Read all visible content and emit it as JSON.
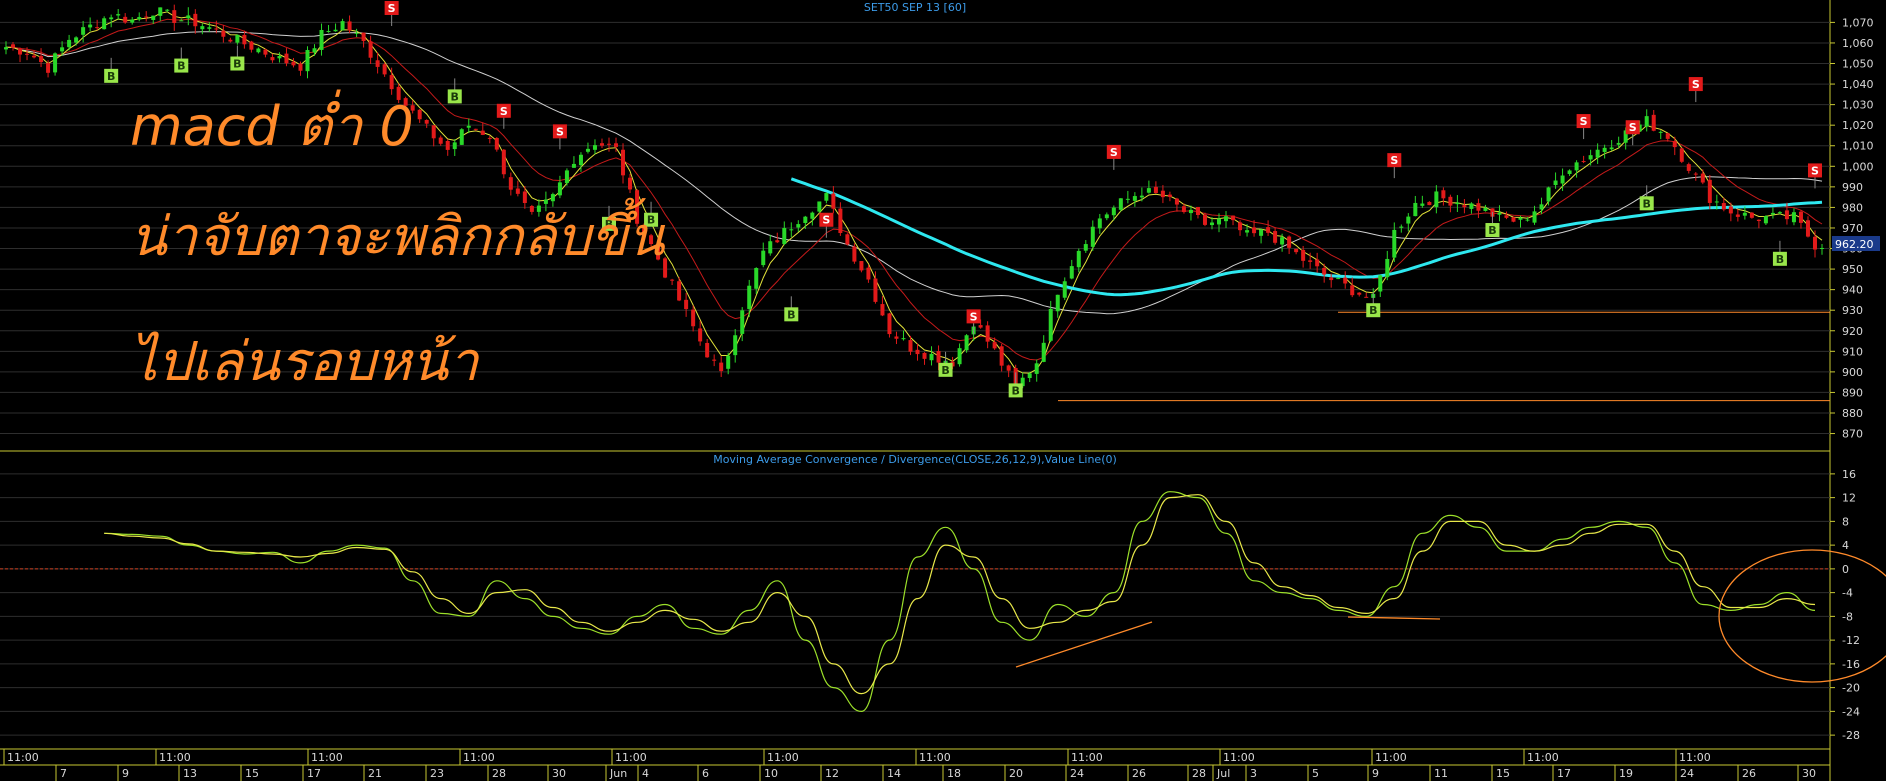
{
  "window": {
    "price_title": "SET50 SEP 13   [60]",
    "macd_title": "Moving Average Convergence / Divergence(CLOSE,26,12,9),Value Line(0)",
    "last_price": "962.20"
  },
  "annotations": [
    "macd ต่ำ 0",
    "น่าจับตาจะพลิกกลับขึ้น",
    "ไปเล่นรอบหน้า"
  ],
  "colors": {
    "background": "#000000",
    "grid": "#2e2e2e",
    "macd_line": "#9ce02a",
    "signal_line": "#e8e84a",
    "ema_cyan": "#2ee8f0",
    "ma_white": "#d0d0d0",
    "ma_red": "#c41a1a",
    "ma_yellow": "#e2e23a",
    "candle_up": "#29d829",
    "candle_down": "#e21a1a",
    "buy_badge": "#99e64a",
    "sell_badge": "#e21a1a",
    "annotation": "#ff8a2a",
    "axis_frame": "#c8c832"
  },
  "x_axis": {
    "top_row": [
      "11:00",
      "11:00",
      "11:00",
      "11:00",
      "11:00",
      "11:00",
      "11:00",
      "11:00",
      "11:00",
      "11:00",
      "11:00",
      "11:00",
      "11:00"
    ],
    "bottom_row": [
      "7",
      "9",
      "13",
      "15",
      "17",
      "21",
      "23",
      "28",
      "30",
      "Jun",
      "4",
      "6",
      "10",
      "12",
      "14",
      "18",
      "20",
      "24",
      "26",
      "28",
      "Jul",
      "3",
      "5",
      "9",
      "11",
      "15",
      "17",
      "19",
      "24",
      "26",
      "30"
    ]
  },
  "chart_data": [
    {
      "type": "candlestick",
      "title": "SET50 SEP 13   [60]",
      "ylim": [
        862,
        1077
      ],
      "yticks": [
        1070,
        1060,
        1050,
        1040,
        1030,
        1020,
        1010,
        1000,
        990,
        980,
        970,
        960,
        950,
        940,
        930,
        920,
        910,
        900,
        890,
        880,
        870
      ],
      "last_value": 962.2,
      "horizontal_lines": [
        886,
        929
      ],
      "close_path": [
        [
          0,
          1058
        ],
        [
          3,
          1056
        ],
        [
          6,
          1048
        ],
        [
          9,
          1062
        ],
        [
          12,
          1068
        ],
        [
          15,
          1074
        ],
        [
          18,
          1071
        ],
        [
          21,
          1076
        ],
        [
          24,
          1072
        ],
        [
          27,
          1070
        ],
        [
          30,
          1066
        ],
        [
          33,
          1061
        ],
        [
          36,
          1057
        ],
        [
          39,
          1052
        ],
        [
          42,
          1049
        ],
        [
          45,
          1064
        ],
        [
          48,
          1070
        ],
        [
          51,
          1060
        ],
        [
          54,
          1045
        ],
        [
          57,
          1030
        ],
        [
          60,
          1018
        ],
        [
          63,
          1008
        ],
        [
          66,
          1020
        ],
        [
          69,
          1015
        ],
        [
          72,
          990
        ],
        [
          75,
          975
        ],
        [
          78,
          985
        ],
        [
          81,
          1004
        ],
        [
          84,
          1012
        ],
        [
          87,
          1008
        ],
        [
          90,
          975
        ],
        [
          93,
          955
        ],
        [
          96,
          935
        ],
        [
          99,
          915
        ],
        [
          102,
          898
        ],
        [
          105,
          932
        ],
        [
          108,
          958
        ],
        [
          111,
          968
        ],
        [
          114,
          978
        ],
        [
          117,
          985
        ],
        [
          120,
          962
        ],
        [
          123,
          945
        ],
        [
          126,
          920
        ],
        [
          129,
          912
        ],
        [
          132,
          908
        ],
        [
          135,
          905
        ],
        [
          138,
          925
        ],
        [
          141,
          910
        ],
        [
          144,
          892
        ],
        [
          147,
          905
        ],
        [
          150,
          940
        ],
        [
          153,
          960
        ],
        [
          156,
          975
        ],
        [
          159,
          982
        ],
        [
          162,
          988
        ],
        [
          165,
          985
        ],
        [
          168,
          978
        ],
        [
          171,
          972
        ],
        [
          174,
          974
        ],
        [
          177,
          966
        ],
        [
          180,
          968
        ],
        [
          183,
          960
        ],
        [
          186,
          952
        ],
        [
          189,
          945
        ],
        [
          192,
          940
        ],
        [
          195,
          935
        ],
        [
          198,
          968
        ],
        [
          201,
          982
        ],
        [
          204,
          985
        ],
        [
          207,
          983
        ],
        [
          210,
          980
        ],
        [
          213,
          975
        ],
        [
          216,
          973
        ],
        [
          219,
          982
        ],
        [
          222,
          998
        ],
        [
          225,
          1004
        ],
        [
          228,
          1010
        ],
        [
          231,
          1016
        ],
        [
          234,
          1022
        ],
        [
          237,
          1015
        ],
        [
          240,
          1000
        ],
        [
          243,
          985
        ],
        [
          246,
          978
        ],
        [
          249,
          975
        ],
        [
          252,
          975
        ],
        [
          255,
          975
        ],
        [
          258,
          962
        ]
      ],
      "signals": [
        {
          "x": 15,
          "side": "B",
          "price": 1044
        },
        {
          "x": 25,
          "side": "B",
          "price": 1049
        },
        {
          "x": 33,
          "side": "B",
          "price": 1050
        },
        {
          "x": 64,
          "side": "B",
          "price": 1034
        },
        {
          "x": 55,
          "side": "S",
          "price": 1077
        },
        {
          "x": 71,
          "side": "S",
          "price": 1027
        },
        {
          "x": 79,
          "side": "S",
          "price": 1017
        },
        {
          "x": 86,
          "side": "B",
          "price": 972
        },
        {
          "x": 92,
          "side": "B",
          "price": 974
        },
        {
          "x": 112,
          "side": "B",
          "price": 928
        },
        {
          "x": 117,
          "side": "S",
          "price": 974
        },
        {
          "x": 134,
          "side": "B",
          "price": 901
        },
        {
          "x": 138,
          "side": "S",
          "price": 927
        },
        {
          "x": 144,
          "side": "B",
          "price": 891
        },
        {
          "x": 158,
          "side": "S",
          "price": 1007
        },
        {
          "x": 195,
          "side": "B",
          "price": 930
        },
        {
          "x": 198,
          "side": "S",
          "price": 1003
        },
        {
          "x": 212,
          "side": "B",
          "price": 969
        },
        {
          "x": 225,
          "side": "S",
          "price": 1022
        },
        {
          "x": 232,
          "side": "S",
          "price": 1019
        },
        {
          "x": 234,
          "side": "B",
          "price": 982
        },
        {
          "x": 241,
          "side": "S",
          "price": 1040
        },
        {
          "x": 253,
          "side": "B",
          "price": 955
        },
        {
          "x": 258,
          "side": "S",
          "price": 998
        }
      ]
    },
    {
      "type": "line",
      "title": "Moving Average Convergence / Divergence(CLOSE,26,12,9),Value Line(0)",
      "ylim": [
        -30,
        18
      ],
      "yticks": [
        16,
        12,
        8,
        4,
        0,
        -4,
        -8,
        -12,
        -16,
        -20,
        -24,
        -28
      ],
      "value_line": 0,
      "series": [
        {
          "name": "MACD",
          "values": [
            [
              14,
              6
            ],
            [
              18,
              5.8
            ],
            [
              22,
              5.5
            ],
            [
              26,
              4
            ],
            [
              30,
              3
            ],
            [
              34,
              2.5
            ],
            [
              38,
              2.8
            ],
            [
              42,
              1
            ],
            [
              46,
              3
            ],
            [
              50,
              4
            ],
            [
              54,
              3.5
            ],
            [
              58,
              -2
            ],
            [
              62,
              -7.5
            ],
            [
              66,
              -8
            ],
            [
              70,
              -2
            ],
            [
              74,
              -5
            ],
            [
              78,
              -8
            ],
            [
              82,
              -10
            ],
            [
              86,
              -11
            ],
            [
              90,
              -8
            ],
            [
              94,
              -6
            ],
            [
              98,
              -10
            ],
            [
              102,
              -11
            ],
            [
              106,
              -7
            ],
            [
              110,
              -2
            ],
            [
              114,
              -12
            ],
            [
              118,
              -20
            ],
            [
              122,
              -24
            ],
            [
              126,
              -12
            ],
            [
              130,
              2
            ],
            [
              134,
              7
            ],
            [
              138,
              0
            ],
            [
              142,
              -9
            ],
            [
              146,
              -12
            ],
            [
              150,
              -6
            ],
            [
              154,
              -8
            ],
            [
              158,
              -4
            ],
            [
              162,
              8
            ],
            [
              166,
              13
            ],
            [
              170,
              12
            ],
            [
              174,
              6
            ],
            [
              178,
              -2
            ],
            [
              182,
              -4
            ],
            [
              186,
              -5
            ],
            [
              190,
              -7
            ],
            [
              194,
              -8
            ],
            [
              198,
              -3
            ],
            [
              202,
              6
            ],
            [
              206,
              9
            ],
            [
              210,
              7
            ],
            [
              214,
              3
            ],
            [
              218,
              3
            ],
            [
              222,
              5
            ],
            [
              226,
              7
            ],
            [
              230,
              8
            ],
            [
              234,
              7
            ],
            [
              238,
              1
            ],
            [
              242,
              -6
            ],
            [
              246,
              -7
            ],
            [
              250,
              -6
            ],
            [
              254,
              -4
            ],
            [
              258,
              -7
            ]
          ]
        },
        {
          "name": "Signal",
          "values": [
            [
              14,
              6
            ],
            [
              18,
              5.5
            ],
            [
              22,
              5.2
            ],
            [
              26,
              4.2
            ],
            [
              30,
              3
            ],
            [
              34,
              2.8
            ],
            [
              38,
              2.5
            ],
            [
              42,
              2
            ],
            [
              46,
              2.6
            ],
            [
              50,
              3.6
            ],
            [
              54,
              3.3
            ],
            [
              58,
              -0.5
            ],
            [
              62,
              -5
            ],
            [
              66,
              -7.5
            ],
            [
              70,
              -4
            ],
            [
              74,
              -3.5
            ],
            [
              78,
              -6.5
            ],
            [
              82,
              -9
            ],
            [
              86,
              -10.5
            ],
            [
              90,
              -9
            ],
            [
              94,
              -7
            ],
            [
              98,
              -8.5
            ],
            [
              102,
              -10.5
            ],
            [
              106,
              -9
            ],
            [
              110,
              -4
            ],
            [
              114,
              -8
            ],
            [
              118,
              -16
            ],
            [
              122,
              -21
            ],
            [
              126,
              -16
            ],
            [
              130,
              -5
            ],
            [
              134,
              4
            ],
            [
              138,
              2
            ],
            [
              142,
              -5
            ],
            [
              146,
              -10
            ],
            [
              150,
              -9
            ],
            [
              154,
              -7
            ],
            [
              158,
              -5.5
            ],
            [
              162,
              4
            ],
            [
              166,
              12
            ],
            [
              170,
              12.5
            ],
            [
              174,
              8
            ],
            [
              178,
              1
            ],
            [
              182,
              -3
            ],
            [
              186,
              -4.5
            ],
            [
              190,
              -6.5
            ],
            [
              194,
              -7.5
            ],
            [
              198,
              -5
            ],
            [
              202,
              3
            ],
            [
              206,
              8
            ],
            [
              210,
              8
            ],
            [
              214,
              4
            ],
            [
              218,
              3
            ],
            [
              222,
              4
            ],
            [
              226,
              6
            ],
            [
              230,
              7.5
            ],
            [
              234,
              7.5
            ],
            [
              238,
              3
            ],
            [
              242,
              -3
            ],
            [
              246,
              -6.5
            ],
            [
              250,
              -6.5
            ],
            [
              254,
              -5
            ],
            [
              258,
              -6
            ]
          ]
        }
      ]
    }
  ]
}
